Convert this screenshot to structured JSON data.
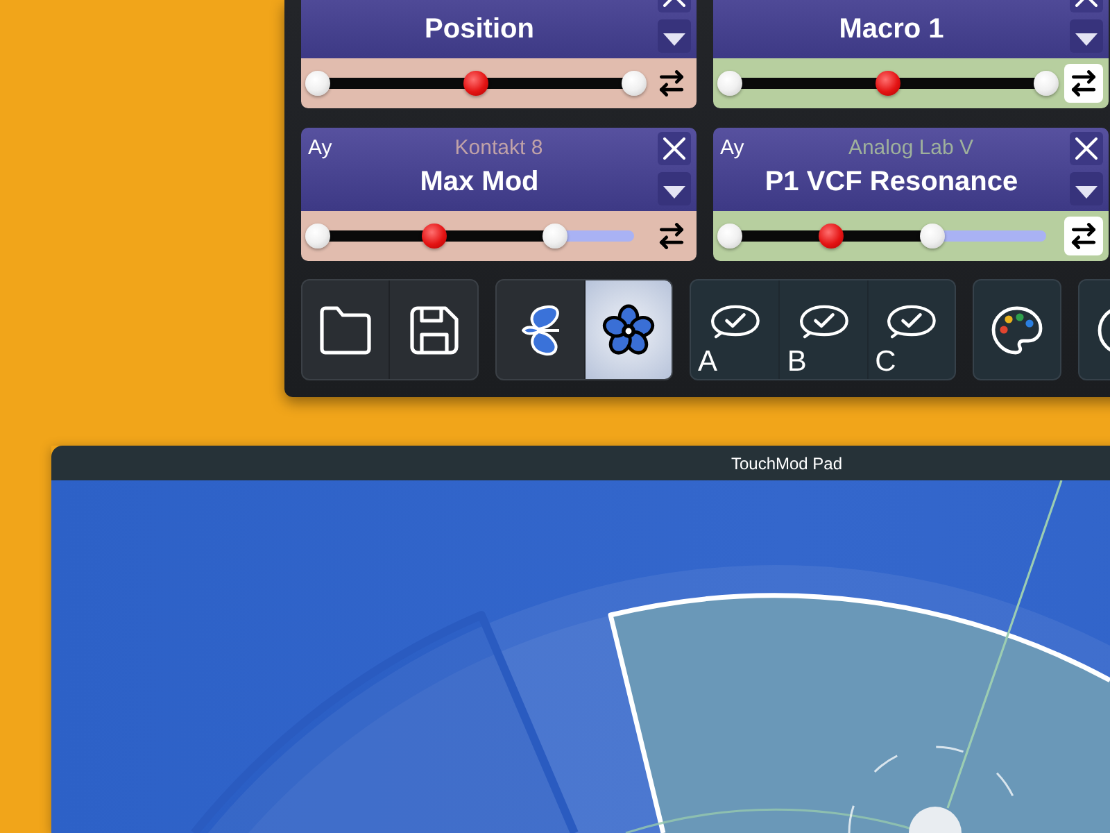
{
  "control_panel": {
    "cards": [
      {
        "color": "#e1bcae",
        "parameter": "Position",
        "slider": {
          "low": {
            "level": 0
          },
          "value": {
            "level": 0.5
          },
          "high": {
            "level": 1
          }
        },
        "swap": {
          "on": false
        }
      },
      {
        "color": "#b7cf9f",
        "parameter": "Macro 1",
        "slider": {
          "low": {
            "level": 0
          },
          "value": {
            "level": 0.5
          },
          "high": {
            "level": 1
          }
        },
        "swap": {
          "on": true
        }
      },
      {
        "axis": "Ay",
        "source": "Kontakt 8",
        "color": "#e1bcae",
        "parameter": "Max Mod",
        "slider": {
          "low": {
            "level": 0
          },
          "value": {
            "level": 0.37
          },
          "high": {
            "level": 0.75
          }
        },
        "swap": {
          "on": false
        }
      },
      {
        "axis": "Ay",
        "source": "Analog Lab V",
        "color": "#b7cf9f",
        "parameter": "P1 VCF Resonance",
        "slider": {
          "low": {
            "level": 0
          },
          "value": {
            "level": 0.32
          },
          "high": {
            "level": 0.64
          }
        },
        "swap": {
          "on": true
        }
      }
    ]
  },
  "toolbar": {
    "modes": [
      {
        "selected": false
      },
      {
        "selected": true
      }
    ],
    "snapshots": [
      {
        "label": "A"
      },
      {
        "label": "B"
      },
      {
        "label": "C"
      }
    ]
  },
  "pad_window": {
    "title": "TouchMod Pad",
    "sectors": [
      {
        "selected": false
      },
      {
        "selected": true
      }
    ]
  }
}
